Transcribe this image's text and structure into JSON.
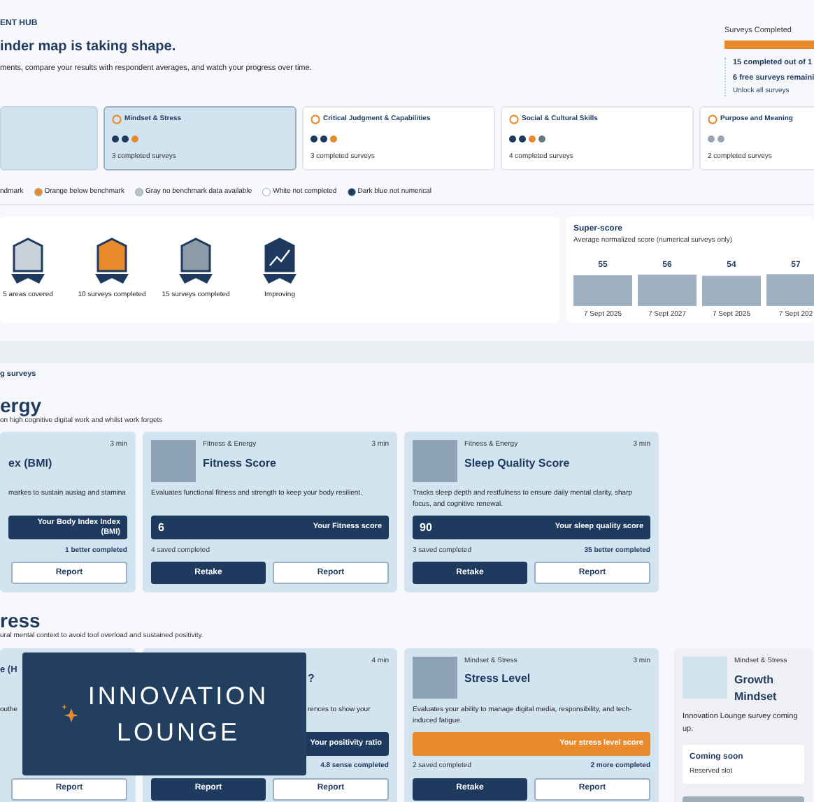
{
  "header": {
    "eyebrow": "ENT HUB",
    "title": "inder map is taking shape.",
    "subtitle": "ments, compare your results with respondent averages, and watch your progress over time."
  },
  "progress": {
    "title": "Surveys Completed",
    "level": 1,
    "lines": [
      "15 completed out of 1",
      "6 free surveys remaini"
    ],
    "link": "Unlock all surveys"
  },
  "categories": [
    {
      "selected": false
    },
    {
      "name": "Mindset & Stress",
      "selected": true,
      "dots": [
        {
          "color": "#1f3a5f"
        },
        {
          "color": "#1f3a5f"
        },
        {
          "color": "#e8892b"
        }
      ],
      "count": "3 completed surveys"
    },
    {
      "name": "Critical Judgment & Capabilities",
      "selected": false,
      "dots": [
        {
          "color": "#1f3a5f"
        },
        {
          "color": "#1f3a5f"
        },
        {
          "color": "#e8892b"
        }
      ],
      "count": "3 completed surveys"
    },
    {
      "name": "Social & Cultural Skills",
      "selected": false,
      "dots": [
        {
          "color": "#1f3a5f"
        },
        {
          "color": "#1f3a5f"
        },
        {
          "color": "#e8892b"
        },
        {
          "color": "#6b7785"
        }
      ],
      "count": "4 completed surveys"
    },
    {
      "name": "Purpose and Meaning",
      "selected": false,
      "dots": [
        {
          "color": "#9aa5b1"
        },
        {
          "color": "#9aa5b1"
        }
      ],
      "count": "2 completed surveys"
    }
  ],
  "legend": [
    {
      "label": "ndmark"
    },
    {
      "label": "Orange below benchmark",
      "color": "#e8892b"
    },
    {
      "label": "Gray no benchmark data available",
      "color": "#b8c2cc"
    },
    {
      "label": "White not completed",
      "color": "#ffffff"
    },
    {
      "label": "Dark blue not numerical",
      "color": "#1f3a5f"
    }
  ],
  "badges": [
    {
      "label": "5 areas covered",
      "kind": "areas"
    },
    {
      "label": "10 surveys completed",
      "kind": "ten"
    },
    {
      "label": "15 surveys completed",
      "kind": "fifteen"
    },
    {
      "label": "Improving",
      "kind": "trend"
    }
  ],
  "superscore": {
    "title": "Super-score",
    "subtitle": "Average normalized score (numerical surveys only)",
    "chart_data": {
      "type": "bar",
      "categories": [
        "7 Sept 2025",
        "7 Sept 2027",
        "7 Sept 2025",
        "7 Sept 202"
      ],
      "series": [
        {
          "color": "#9fb0c0",
          "values": [
            55,
            56,
            54,
            57
          ]
        }
      ],
      "data_labels": true
    }
  },
  "list_label": "g surveys",
  "sections": [
    {
      "title": "ergy",
      "subtitle": "on high cognitive digital work and whilst work forgets",
      "cards": [
        {
          "kind": "survey",
          "duration": "3 min",
          "title": "ex (BMI)",
          "description": "markes to sustain ausiag and stamina",
          "score": {
            "label": "Your Body Index Index (BMI)",
            "kind": "navy"
          },
          "right_note": "1 better completed",
          "buttons": [
            {
              "label": "Report",
              "kind": "secondary"
            }
          ]
        },
        {
          "kind": "survey",
          "category": "Fitness & Energy",
          "duration": "3 min",
          "title": "Fitness Score",
          "description": "Evaluates functional fitness and strength to keep your body resilient.",
          "score": {
            "value": "6",
            "label": "Your Fitness score",
            "kind": "navy"
          },
          "left_note": "4 saved completed",
          "buttons": [
            {
              "label": "Retake",
              "kind": "primary"
            },
            {
              "label": "Report",
              "kind": "secondary"
            }
          ]
        },
        {
          "kind": "survey",
          "category": "Fitness & Energy",
          "duration": "3 min",
          "title": "Sleep Quality Score",
          "description": "Tracks sleep depth and restfulness to ensure daily mental clarity, sharp focus, and cognitive renewal.",
          "score": {
            "value": "90",
            "label": "Your sleep quality score",
            "kind": "navy"
          },
          "left_note": "3 saved completed",
          "right_note": "35 better completed",
          "buttons": [
            {
              "label": "Retake",
              "kind": "primary"
            },
            {
              "label": "Report",
              "kind": "secondary"
            }
          ]
        }
      ]
    },
    {
      "title": "ress",
      "subtitle": "ural mental context to avoid tool overload and sustained positivity.",
      "cards": [
        {
          "kind": "survey",
          "title": "e (H",
          "description": "outhe",
          "buttons": [
            {
              "label": "Report",
              "kind": "secondary"
            }
          ]
        },
        {
          "kind": "survey",
          "duration": "4 min",
          "title": "?",
          "description": "rences to show your",
          "score": {
            "label": "Your positivity ratio",
            "kind": "navy"
          },
          "right_note": "4.8 sense completed",
          "buttons": [
            {
              "label": "Report",
              "kind": "primary"
            },
            {
              "label": "Report",
              "kind": "secondary"
            }
          ]
        },
        {
          "kind": "survey",
          "category": "Mindset & Stress",
          "duration": "3 min",
          "title": "Stress Level",
          "description": "Evaluates your ability to manage digital media, responsibility, and tech-induced fatigue.",
          "score": {
            "label": "Your stress level score",
            "kind": "orange"
          },
          "left_note": "2 saved completed",
          "right_note": "2 more completed",
          "buttons": [
            {
              "label": "Retake",
              "kind": "primary"
            },
            {
              "label": "Report",
              "kind": "secondary"
            }
          ]
        },
        {
          "kind": "coming_soon",
          "category": "Mindset & Stress",
          "title": "Growth Mindset",
          "description": "Innovation Lounge survey coming up.",
          "soon": {
            "title": "Coming soon",
            "note": "Reserved slot"
          }
        }
      ]
    }
  ],
  "logo": {
    "lines": [
      "INNOVATION",
      "LOUNGE"
    ]
  }
}
